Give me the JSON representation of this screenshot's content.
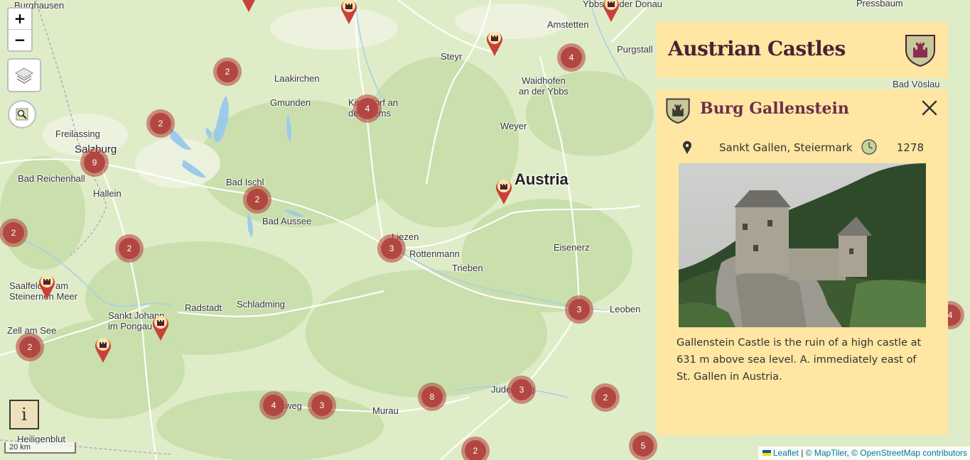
{
  "app": {
    "title": "Austrian Castles",
    "crest_icon": "castle-crest-icon",
    "accent_color": "#ffe6a2",
    "marker_color": "#b24741"
  },
  "map": {
    "country_label": "Austria",
    "places": [
      "Burghausen",
      "Ybbs an der Donau",
      "Pressbaum",
      "Amstetten",
      "Steyr",
      "Purgstall",
      "Laakirchen",
      "Waidhofen an der Ybbs",
      "Gmunden",
      "Kirchdorf an der Krems",
      "Freilassing",
      "Salzburg",
      "Weyer",
      "Bad Vöslau",
      "Bad Reichenhall",
      "Hallein",
      "Bad Ischl",
      "Bad Aussee",
      "Liezen",
      "Rottenmann",
      "Eisenerz",
      "Trieben",
      "Saalfelden am Steinernen Meer",
      "Radstadt",
      "Schladming",
      "Sankt Johann im Pongau",
      "Leoben",
      "Zell am See",
      "Judenburg",
      "Tamsweg",
      "Murau",
      "Heiligenblut"
    ],
    "clusters": [
      "2",
      "2",
      "4",
      "4",
      "9",
      "2",
      "2",
      "2",
      "3",
      "2",
      "3",
      "8",
      "3",
      "2",
      "4",
      "3",
      "5",
      "2",
      "4"
    ],
    "castle_markers": 8
  },
  "controls": {
    "zoom_in": "+",
    "zoom_out": "−",
    "layers_icon": "layers-icon",
    "search_icon": "search-icon",
    "info_label": "i",
    "scale": "20 km"
  },
  "attribution": {
    "leaflet": "Leaflet",
    "sep1": " | ",
    "maptiler": "© MapTiler",
    "sep2": ", ",
    "osm": "© OpenStreetMap contributors"
  },
  "detail": {
    "name": "Burg Gallenstein",
    "location": "Sankt Gallen, Steiermark",
    "year": "1278",
    "description": "Gallenstein Castle is the ruin of a high castle at 631 m above sea level. A. immediately east of St. Gallen in Austria.",
    "close_icon": "close-icon",
    "location_icon": "location-pin-icon",
    "clock_icon": "clock-icon"
  }
}
